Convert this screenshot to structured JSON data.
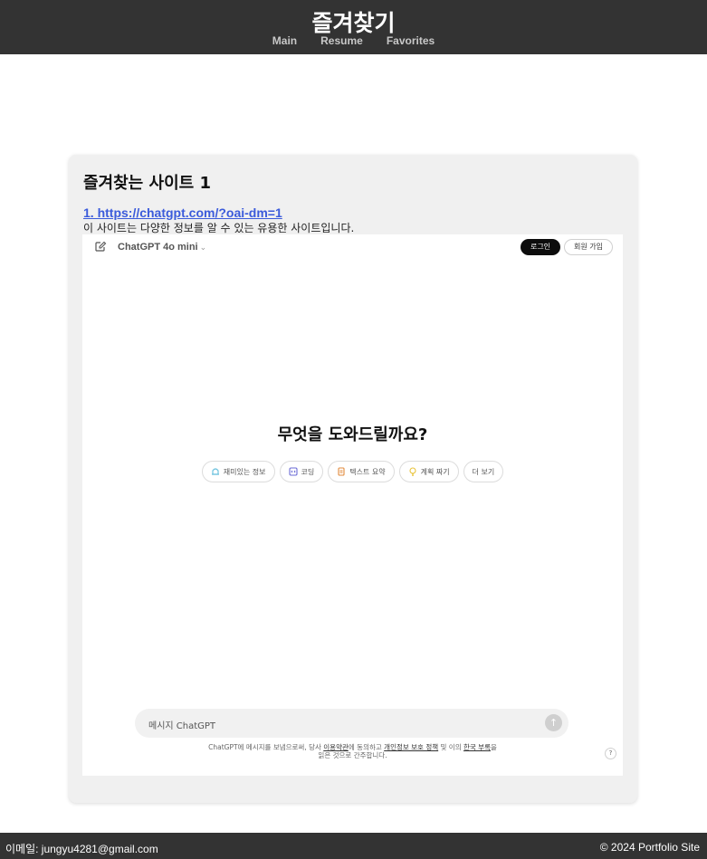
{
  "header": {
    "title": "즐겨찾기",
    "nav": [
      "Main",
      "Resume",
      "Favorites"
    ]
  },
  "card": {
    "heading": "즐겨찾는 사이트 1",
    "link_text": "1. https://chatgpt.com/?oai-dm=1",
    "description": "이 사이트는 다양한 정보를 알 수 있는 유용한 사이트입니다.",
    "preview": {
      "edit_icon": "edit-icon",
      "model_label": "ChatGPT 4o mini",
      "model_chevron": "⌄",
      "login_label": "로그인",
      "signup_label": "회원 가입",
      "headline": "무엇을 도와드릴까요?",
      "chips": [
        {
          "label": "재미있는 정보",
          "icon": "hat-icon",
          "color": "#6fc3df"
        },
        {
          "label": "코딩",
          "icon": "code-icon",
          "color": "#6b6bd6"
        },
        {
          "label": "텍스트 요약",
          "icon": "document-icon",
          "color": "#e28a3b"
        },
        {
          "label": "계획 짜기",
          "icon": "lightbulb-icon",
          "color": "#e8c33a"
        },
        {
          "label": "더 보기",
          "icon": "",
          "color": ""
        }
      ],
      "input_placeholder": "메시지 ChatGPT",
      "send_icon": "↑",
      "disclaimer_pre": "ChatGPT에 메시지를 보냄으로써, 당사 ",
      "disclaimer_terms": "이용약관",
      "disclaimer_mid": "에 동의하고 ",
      "disclaimer_privacy": "개인정보 보호 정책",
      "disclaimer_mid2": " 및 이의 ",
      "disclaimer_appendix": "한국 부록",
      "disclaimer_post": "을",
      "disclaimer_line2": "읽은 것으로 간주합니다.",
      "help_label": "?"
    }
  },
  "footer": {
    "email": "이메일: jungyu4281@gmail.com",
    "copyright": "© 2024 Portfolio Site"
  },
  "colors": {
    "header_bg": "#333333",
    "card_bg": "#f0f0f0",
    "link": "#3b5bdb"
  }
}
